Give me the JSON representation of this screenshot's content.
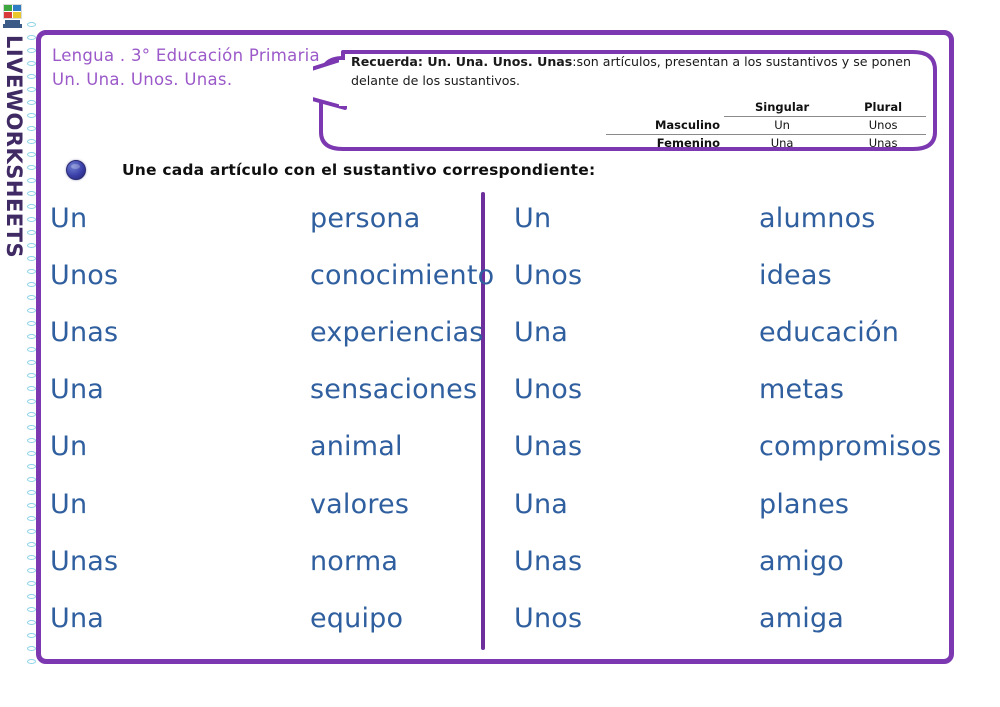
{
  "brand": {
    "wordmark": "LIVEWORKSHEETS",
    "logo_icon": "liveworksheets-logo-icon",
    "purple": "#7b38b0",
    "blue": "#2f5f9f"
  },
  "title": {
    "line1": "Lengua . 3° Educación Primaria",
    "line2": "Un. Una. Unos. Unas."
  },
  "recuerda": {
    "lead": "Recuerda: ",
    "articles": "Un. Una. Unos. Unas",
    "body": ":son artículos, presentan a los sustantivos y se ponen delante de los sustantivos.",
    "table": {
      "col_headers": [
        "",
        "Singular",
        "Plural"
      ],
      "rows": [
        {
          "label": "Masculino",
          "singular": "Un",
          "plural": "Unos"
        },
        {
          "label": "Femenino",
          "singular": "Una",
          "plural": "Unas"
        }
      ]
    }
  },
  "instruction": {
    "icon": "blue-bullet-icon",
    "text": "Une cada artículo con el sustantivo correspondiente:"
  },
  "exercise": {
    "left_column": [
      {
        "article": "Un",
        "noun": "persona"
      },
      {
        "article": "Unos",
        "noun": "conocimiento"
      },
      {
        "article": "Unas",
        "noun": "experiencias"
      },
      {
        "article": "Una",
        "noun": "sensaciones"
      },
      {
        "article": "Un",
        "noun": "animal"
      },
      {
        "article": "Un",
        "noun": "valores"
      },
      {
        "article": "Unas",
        "noun": "norma"
      },
      {
        "article": "Una",
        "noun": "equipo"
      }
    ],
    "right_column": [
      {
        "article": "Un",
        "noun": "alumnos"
      },
      {
        "article": "Unos",
        "noun": "ideas"
      },
      {
        "article": "Una",
        "noun": "educación"
      },
      {
        "article": "Unos",
        "noun": "metas"
      },
      {
        "article": "Unas",
        "noun": "compromisos"
      },
      {
        "article": "Una",
        "noun": "planes"
      },
      {
        "article": "Unas",
        "noun": "amigo"
      },
      {
        "article": "Unos",
        "noun": "amiga"
      }
    ]
  }
}
